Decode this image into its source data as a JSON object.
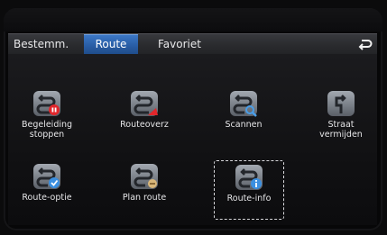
{
  "tabs": [
    {
      "label": "Bestemm.",
      "active": false
    },
    {
      "label": "Route",
      "active": true
    },
    {
      "label": "Favoriet",
      "active": false
    }
  ],
  "back_icon": "return-arrow-icon",
  "items": [
    {
      "label": "Begeleiding\nstoppen",
      "icon": "route-stop-icon",
      "badge_color": "#e2262b"
    },
    {
      "label": "Routeoverz",
      "icon": "route-overview-icon",
      "badge_color": "#e2262b"
    },
    {
      "label": "Scannen",
      "icon": "route-scan-icon",
      "badge_color": "#4a9ee8"
    },
    {
      "label": "Straat\nvermijden",
      "icon": "avoid-street-icon",
      "badge_color": ""
    },
    {
      "label": "Route-optie",
      "icon": "route-option-icon",
      "badge_color": "#3b8fe0"
    },
    {
      "label": "Plan route",
      "icon": "plan-route-icon",
      "badge_color": "#d9b77a"
    },
    {
      "label": "Route-info",
      "icon": "route-info-icon",
      "badge_color": "#3b8fe0",
      "selected": true
    }
  ],
  "colors": {
    "tab_active": "#2a5fa7",
    "icon_gradient_top": "#9aa0a8",
    "icon_gradient_bottom": "#5c6169"
  }
}
